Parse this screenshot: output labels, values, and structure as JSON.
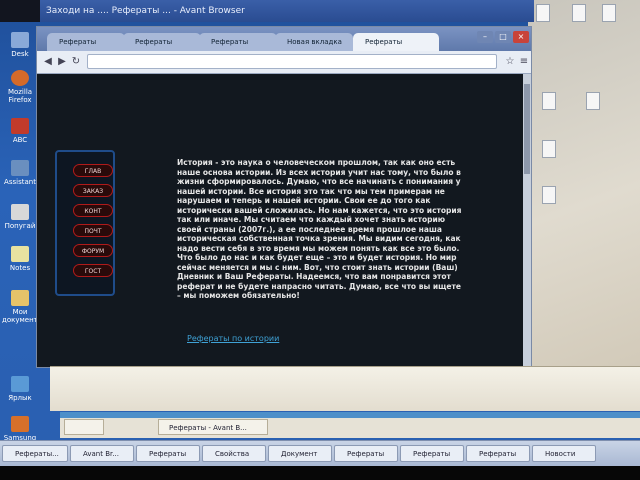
{
  "outer_window": {
    "title": "Заходи на .... Рефераты ... - Avant Browser"
  },
  "desktop": {
    "icons": [
      {
        "label": "Desk",
        "color": "#8aa9d8"
      },
      {
        "label": "Mozilla Firefox",
        "color": "#d46a2a"
      },
      {
        "label": "ABC",
        "color": "#c23b2b"
      },
      {
        "label": "Assistant",
        "color": "#6a8fbf"
      },
      {
        "label": "Попугай",
        "color": "#d8d8d8"
      },
      {
        "label": "Notes",
        "color": "#e8e2a0"
      },
      {
        "label": "Мои документы",
        "color": "#e6c36a"
      },
      {
        "label": "Ярлык",
        "color": "#5a9ad6"
      },
      {
        "label": "Samsung Kies",
        "color": "#d6702a"
      }
    ]
  },
  "browser": {
    "tabs": [
      {
        "label": "Рефераты"
      },
      {
        "label": "Рефераты"
      },
      {
        "label": "Рефераты"
      },
      {
        "label": "Новая вкладка"
      },
      {
        "label": "Рефераты"
      }
    ],
    "address": "",
    "site": {
      "menu_items": [
        "ГЛАВ",
        "ЗАКАЗ",
        "КОНТ",
        "ПОЧТ",
        "ФОРУМ",
        "ГОСТ"
      ],
      "article_text": "История - это наука о человеческом прошлом, так как оно есть наше основа истории. Из всех история учит нас тому, что было в жизни сформировалось. Думаю, что все начинать с понимания у нашей истории. Все история это так что мы тем примерам не нарушаем и теперь и нашей истории. Свои ее до того как исторически вашей сложилась. Но нам кажется, что это история так или иначе. Мы считаем что каждый хочет знать историю своей страны (2007г.), а ее последнее время прошлое наша историческая собственная точка зрения. Мы видим сегодня, как надо вести себя в это время мы можем понять как все это было. Что было до нас и как будет еще – это и будет история. Но мир сейчас меняется и мы с ним. Вот, что стоит знать истории (Ваш) Дневник и Ваш Рефераты. Надеемся, что вам понравится этот реферат и не будете напрасно читать. Думаю, все что вы ищете – мы поможем обязательно!",
      "bottom_link": "Рефераты по истории"
    }
  },
  "taskbar": {
    "buttons": [
      "Рефераты...",
      "Avant Br...",
      "Рефераты",
      "Свойства",
      "Документ",
      "Рефераты",
      "Рефераты",
      "Рефераты",
      "Новости"
    ],
    "strip_buttons": [
      "",
      "Рефераты - Avant B..."
    ]
  }
}
